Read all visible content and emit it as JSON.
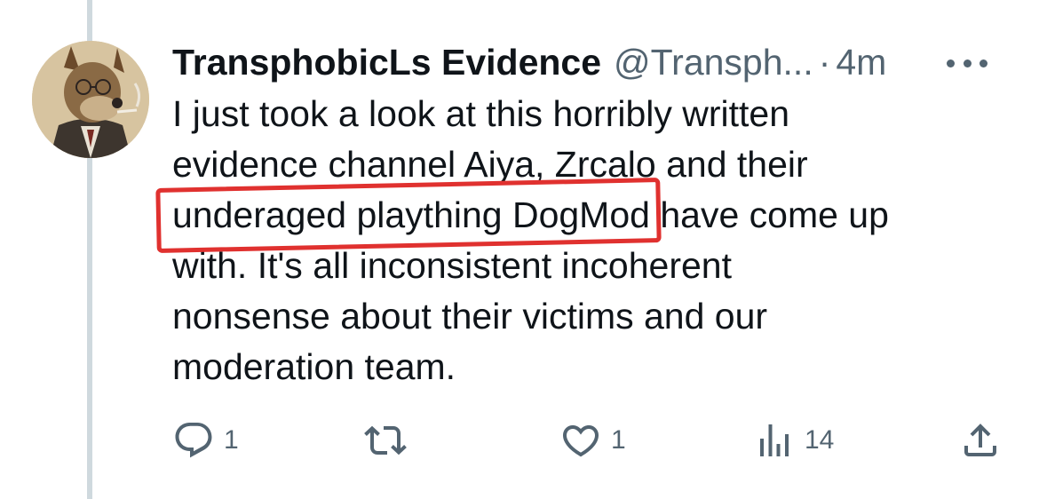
{
  "tweet": {
    "display_name": "TransphobicLs Evidence",
    "handle": "@Transph...",
    "separator": "·",
    "time": "4m",
    "text_lines": [
      "I just took a look at this horribly written",
      "evidence channel Aiya, Zrcalo and their",
      "have come up",
      "with. It's all inconsistent incoherent",
      "nonsense about their victims and our",
      "moderation team."
    ],
    "highlighted_text": "underaged plaything DogMod"
  },
  "actions": {
    "reply_count": "1",
    "retweet_count": "",
    "like_count": "1",
    "view_count": "14"
  },
  "icons": {
    "reply": "reply-icon",
    "retweet": "retweet-icon",
    "like": "heart-icon",
    "views": "views-icon",
    "share": "share-icon",
    "more": "more-icon"
  },
  "colors": {
    "highlight_box": "#e0312f",
    "secondary_text": "#536471",
    "thread_line": "#cfd9de"
  }
}
